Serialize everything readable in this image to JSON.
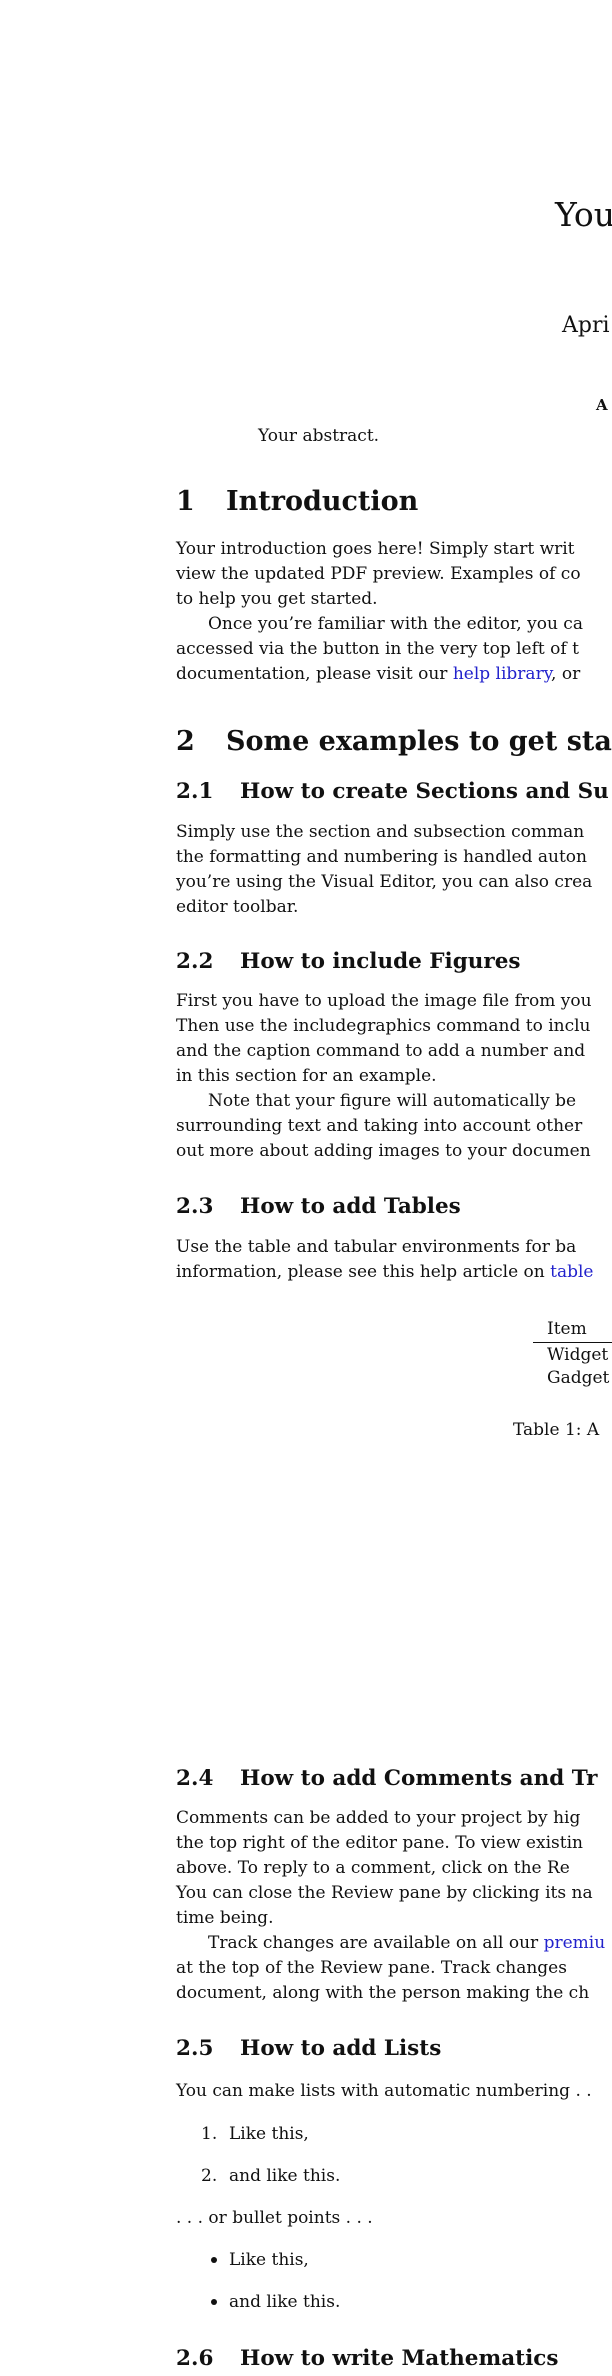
{
  "title": "You",
  "date": "Apri",
  "abstract_heading": "A",
  "abstract_text": "Your abstract.",
  "sections": {
    "s1": {
      "num": "1",
      "title": "Introduction"
    },
    "s2": {
      "num": "2",
      "title": "Some examples to get star"
    },
    "s21": {
      "num": "2.1",
      "title": "How to create Sections and Su"
    },
    "s22": {
      "num": "2.2",
      "title": "How to include Figures"
    },
    "s23": {
      "num": "2.3",
      "title": "How to add Tables"
    },
    "s24": {
      "num": "2.4",
      "title": "How to add Comments and Tr"
    },
    "s25": {
      "num": "2.5",
      "title": "How to add Lists"
    },
    "s26": {
      "num": "2.6",
      "title": "How to write Mathematics"
    }
  },
  "intro": {
    "l1": "Your introduction goes here! Simply start writ",
    "l2": "view the updated PDF preview. Examples of co",
    "l3": "to help you get started.",
    "l4": "Once you’re familiar with the editor, you ca",
    "l5": "accessed via the button in the very top left of t",
    "l6_pre": "documentation, please visit our ",
    "l6_link": "help library",
    "l6_post": ", or"
  },
  "sec21": {
    "l1": "Simply use the section and subsection comman",
    "l2": "the formatting and numbering is handled auton",
    "l3": "you’re using the Visual Editor, you can also crea",
    "l4": "editor toolbar."
  },
  "sec22": {
    "l1": "First you have to upload the image file from you",
    "l2": "Then use the includegraphics command to inclu",
    "l3": "and the caption command to add a number and",
    "l4": "in this section for an example.",
    "l5": "Note that your figure will automatically be",
    "l6": "surrounding text and taking into account other",
    "l7": "out more about adding images to your documen"
  },
  "sec23": {
    "l1": "Use the table and tabular environments for ba",
    "l2_pre": "information, please see this help article on ",
    "l2_link": "table"
  },
  "table": {
    "header": "Item",
    "rows": [
      "Widget",
      "Gadget"
    ],
    "caption": "Table 1: A"
  },
  "sec24": {
    "l1": "Comments can be added to your project by hig",
    "l2": "the top right of the editor pane. To view existin",
    "l3": "above. To reply to a comment, click on the Re",
    "l4": "You can close the Review pane by clicking its na",
    "l5": "time being.",
    "l6_pre": "Track changes are available on all our ",
    "l6_link": "premiu",
    "l7": "at the top of the Review pane. Track changes",
    "l8": "document, along with the person making the ch"
  },
  "sec25": {
    "intro": "You can make lists with automatic numbering . .",
    "numbered": [
      {
        "num": "1.",
        "text": "Like this,"
      },
      {
        "num": "2.",
        "text": "and like this."
      }
    ],
    "bullet_intro": ". . . or bullet points . . .",
    "bullets": [
      "Like this,",
      "and like this."
    ]
  }
}
